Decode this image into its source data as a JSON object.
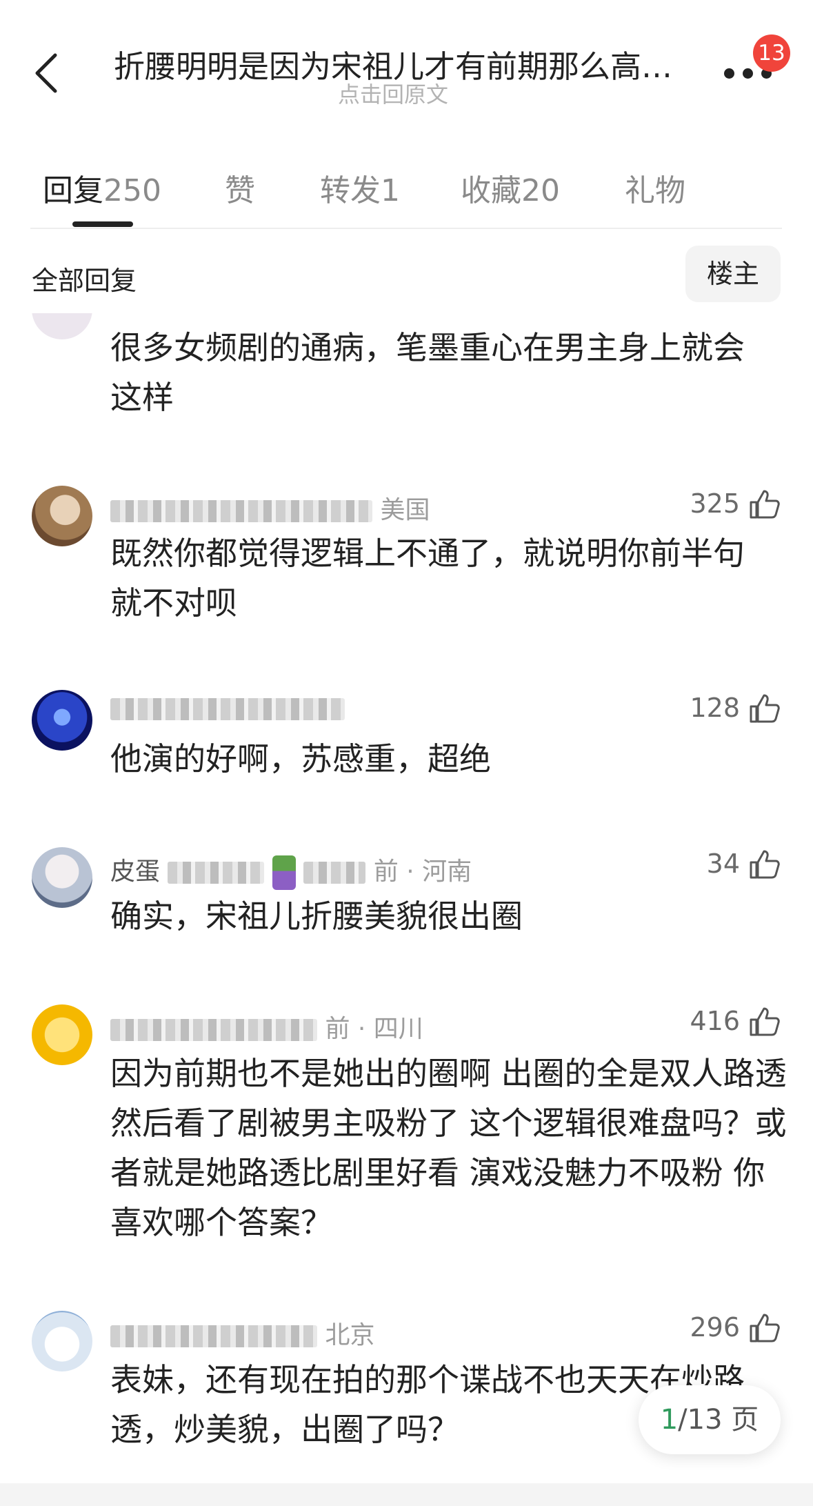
{
  "header": {
    "title": "折腰明明是因为宋祖儿才有前期那么高…",
    "subtitle": "点击回原文",
    "notification_count": "13"
  },
  "tabs": [
    {
      "label": "回复",
      "count": "250",
      "active": true
    },
    {
      "label": "赞",
      "count": "",
      "active": false
    },
    {
      "label": "转发",
      "count": "1",
      "active": false
    },
    {
      "label": "收藏",
      "count": "20",
      "active": false
    },
    {
      "label": "礼物",
      "count": "",
      "active": false
    }
  ],
  "section": {
    "all_replies_label": "全部回复",
    "op_button_label": "楼主"
  },
  "comments": [
    {
      "text": "很多女频剧的通病，笔墨重心在男主身上就会这样",
      "location": "",
      "likes": ""
    },
    {
      "text": "既然你都觉得逻辑上不通了，就说明你前半句就不对呗",
      "location": "美国",
      "likes": "325"
    },
    {
      "text": "他演的好啊，苏感重，超绝",
      "location": "",
      "likes": "128"
    },
    {
      "text": "确实，宋祖儿折腰美貌很出圈",
      "username_prefix": "皮蛋",
      "time_suffix": "前 · 河南",
      "likes": "34"
    },
    {
      "text": "因为前期也不是她出的圈啊 出圈的全是双人路透 然后看了剧被男主吸粉了 这个逻辑很难盘吗？或者就是她路透比剧里好看 演戏没魅力不吸粉 你喜欢哪个答案？",
      "time_suffix": "前 · 四川",
      "likes": "416"
    },
    {
      "text": "表妹，还有现在拍的那个谍战不也天天在炒路透，炒美貌，出圈了吗？",
      "time_suffix": "北京",
      "likes": "296"
    }
  ],
  "pager": {
    "current": "1",
    "total": "/13 页"
  },
  "colors": {
    "accent_green": "#2f9a5c",
    "badge_red": "#f0443b"
  }
}
